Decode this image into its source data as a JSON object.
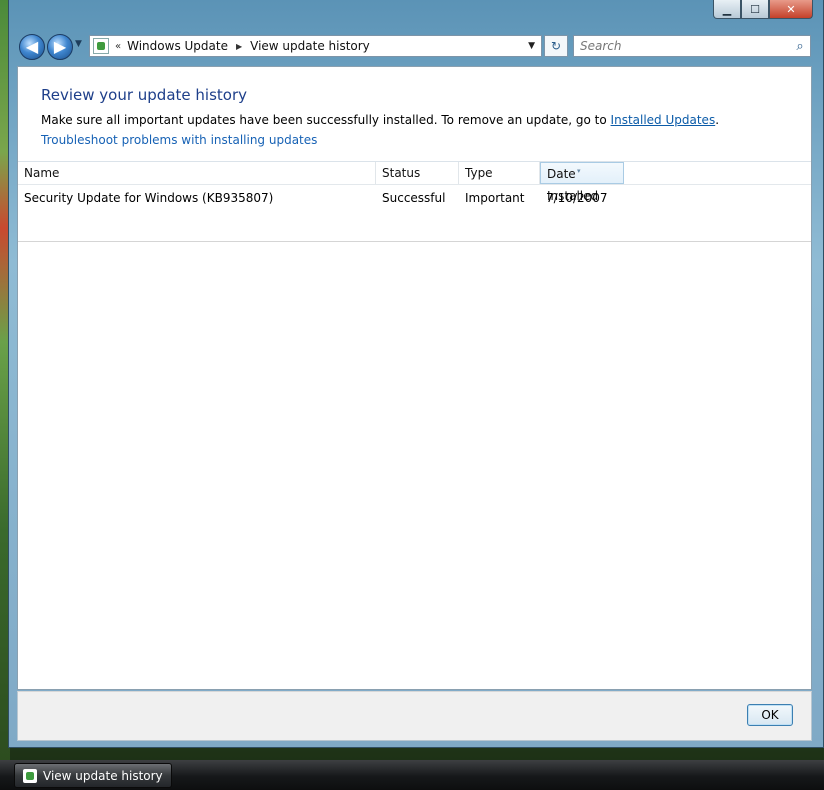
{
  "window": {
    "caption": {
      "minimize": "▁",
      "maximize": "☐",
      "close": "✕"
    }
  },
  "nav": {
    "back": "◀",
    "forward": "▶",
    "recent_arrow": "▼",
    "crumb_sep": "«",
    "breadcrumb": [
      "Windows Update",
      "View update history"
    ],
    "breadcrumb_arrow": "▶",
    "address_dropdown": "▼",
    "refresh": "↻",
    "search_placeholder": "Search",
    "search_glyph": "⌕"
  },
  "main": {
    "title": "Review your update history",
    "description_prefix": "Make sure all important updates have been successfully installed. To remove an update, go to ",
    "installed_updates_link": "Installed Updates",
    "description_suffix": ".",
    "troubleshoot_link": "Troubleshoot problems with installing updates"
  },
  "table": {
    "columns": [
      "Name",
      "Status",
      "Type",
      "Date Installed"
    ],
    "sorted_column": "Date Installed",
    "sort_glyph": "▾",
    "rows": [
      {
        "name": "Security Update for Windows (KB935807)",
        "status": "Successful",
        "type": "Important",
        "date": "7/10/2007"
      }
    ]
  },
  "footer": {
    "ok_label": "OK"
  },
  "taskbar": {
    "active_task": "View update history"
  }
}
